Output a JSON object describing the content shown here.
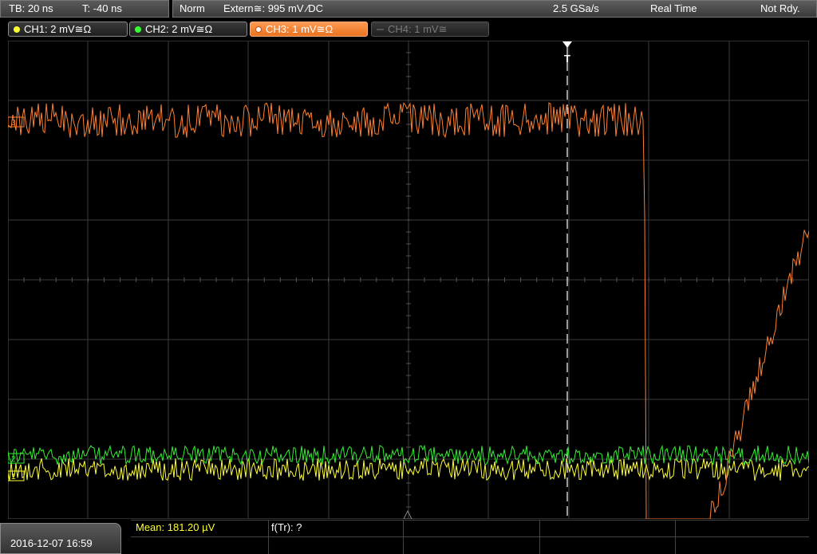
{
  "header": {
    "timebase": "TB: 20 ns",
    "trigger_time": "T: -40 ns",
    "mode": "Norm",
    "trigger_source": "Extern≅: 995 mV ⁄DC",
    "sample_rate": "2.5 GSa/s",
    "acquisition": "Real Time",
    "state": "Not Rdy."
  },
  "channels": [
    {
      "label": "CH1: 2 mV≅Ω",
      "color": "#ffff33",
      "active": false,
      "enabled": true
    },
    {
      "label": "CH2: 2 mV≅Ω",
      "color": "#33ff33",
      "active": false,
      "enabled": true
    },
    {
      "label": "CH3: 1 mV≅Ω",
      "color": "#ff8030",
      "active": true,
      "enabled": true
    },
    {
      "label": "CH4: 1 mV≅",
      "color": "#666666",
      "active": false,
      "enabled": false
    }
  ],
  "markers": {
    "trigger": "T",
    "ch3": "3",
    "ch2": "2",
    "ch1": "1"
  },
  "footer": {
    "datetime": "2016-12-07 16:59",
    "mean": "Mean: 181.20 µV",
    "ftr": "f(Tr): ?"
  },
  "colors": {
    "ch1": "#ffff33",
    "ch2": "#33ff33",
    "ch3": "#ff8030",
    "grid": "#3c3c3c",
    "background": "#000000"
  }
}
